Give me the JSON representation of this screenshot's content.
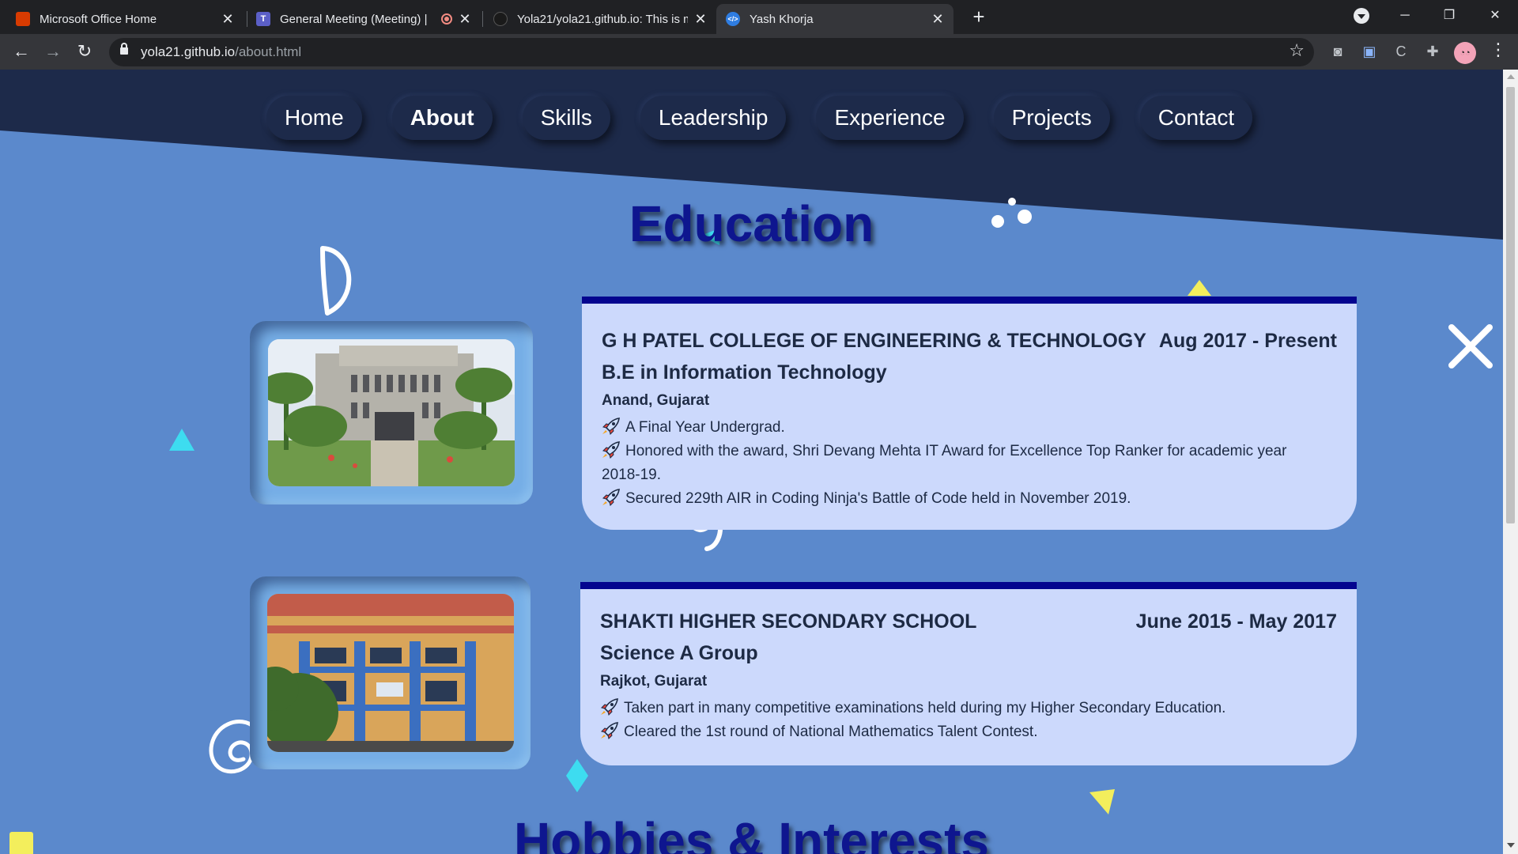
{
  "browser": {
    "tabs": [
      {
        "title": "Microsoft Office Home",
        "icon": "office-icon",
        "active": false
      },
      {
        "title": "General Meeting (Meeting) |",
        "icon": "teams-icon",
        "active": false,
        "recording": true
      },
      {
        "title": "Yola21/yola21.github.io: This is m",
        "icon": "github-icon",
        "active": false
      },
      {
        "title": "Yash Khorja",
        "icon": "code-icon",
        "active": true
      }
    ],
    "url_host": "yola21.github.io",
    "url_path": "/about.html"
  },
  "nav": {
    "items": [
      {
        "label": "Home",
        "active": false
      },
      {
        "label": "About",
        "active": true
      },
      {
        "label": "Skills",
        "active": false
      },
      {
        "label": "Leadership",
        "active": false
      },
      {
        "label": "Experience",
        "active": false
      },
      {
        "label": "Projects",
        "active": false
      },
      {
        "label": "Contact",
        "active": false
      }
    ]
  },
  "education": {
    "title": "Education",
    "entries": [
      {
        "institution": "G H PATEL COLLEGE OF ENGINEERING & TECHNOLOGY",
        "dates": "Aug 2017 - Present",
        "degree": "B.E in Information Technology",
        "location": "Anand, Gujarat",
        "bullets": [
          "A Final Year Undergrad.",
          "Honored with the award, Shri Devang Mehta IT Award for Excellence Top Ranker for academic year 2018-19.",
          "Secured 229th AIR in Coding Ninja's Battle of Code held in November 2019."
        ]
      },
      {
        "institution": "SHAKTI HIGHER SECONDARY SCHOOL",
        "dates": "June 2015 - May 2017",
        "degree": "Science A Group",
        "location": "Rajkot, Gujarat",
        "bullets": [
          "Taken part in many competitive examinations held during my Higher Secondary Education.",
          "Cleared the 1st round of National Mathematics Talent Contest."
        ]
      }
    ]
  },
  "hobbies": {
    "title": "Hobbies & Interests"
  },
  "colors": {
    "page_bg": "#5b89cc",
    "dark_navy": "#1d2a4a",
    "heading": "#0e168f",
    "card_bg": "#ccd9fc",
    "card_border": "#04058f"
  }
}
